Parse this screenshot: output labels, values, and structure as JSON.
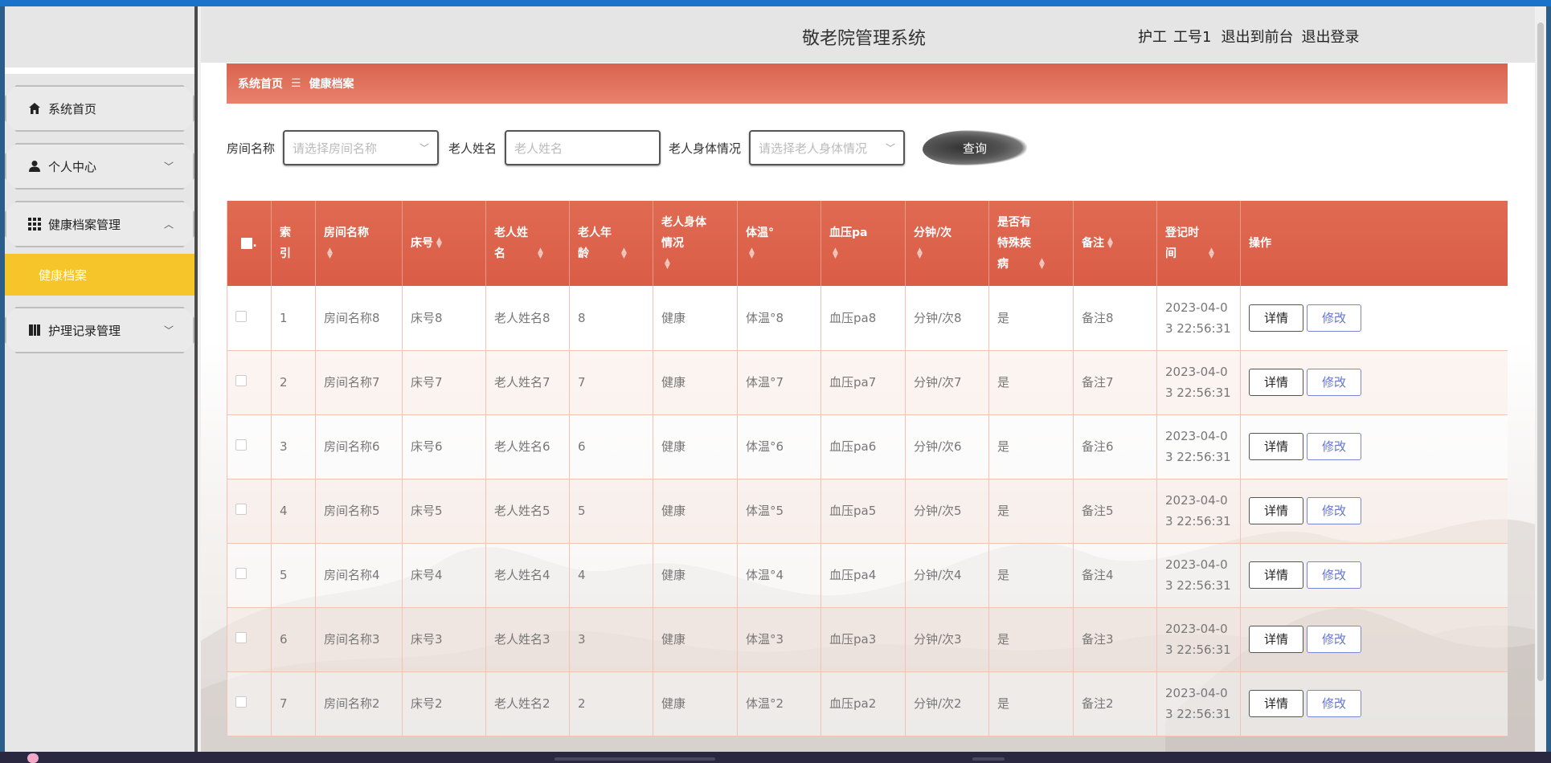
{
  "header": {
    "title": "敬老院管理系统",
    "role": "护工",
    "username": "工号1",
    "front_link": "退出到前台",
    "logout_link": "退出登录"
  },
  "sidebar": {
    "items": [
      {
        "label": "系统首页",
        "icon": "home-icon"
      },
      {
        "label": "个人中心",
        "icon": "user-icon"
      },
      {
        "label": "健康档案管理",
        "icon": "grid-icon"
      },
      {
        "label": "健康档案",
        "icon": ""
      },
      {
        "label": "护理记录管理",
        "icon": "book-icon"
      }
    ]
  },
  "breadcrumb": {
    "home": "系统首页",
    "separator": "☰",
    "current": "健康档案"
  },
  "search": {
    "room_label": "房间名称",
    "room_placeholder": "请选择房间名称",
    "name_label": "老人姓名",
    "name_placeholder": "老人姓名",
    "health_label": "老人身体情况",
    "health_placeholder": "请选择老人身体情况",
    "query_button": "查询"
  },
  "table": {
    "columns": [
      "索引",
      "房间名称",
      "床号",
      "老人姓名",
      "老人年龄",
      "老人身体情况",
      "体温°",
      "血压pa",
      "分钟/次",
      "是否有特殊疾病",
      "备注",
      "登记时间",
      "操作"
    ],
    "detail_label": "详情",
    "edit_label": "修改",
    "rows": [
      {
        "index": "1",
        "room": "房间名称8",
        "bed": "床号8",
        "name": "老人姓名8",
        "age": "8",
        "health": "健康",
        "temp": "体温°8",
        "bp": "血压pa8",
        "rate": "分钟/次8",
        "disease": "是",
        "note": "备注8",
        "time1": "2023-04-0",
        "time2": "3 22:56:31"
      },
      {
        "index": "2",
        "room": "房间名称7",
        "bed": "床号7",
        "name": "老人姓名7",
        "age": "7",
        "health": "健康",
        "temp": "体温°7",
        "bp": "血压pa7",
        "rate": "分钟/次7",
        "disease": "是",
        "note": "备注7",
        "time1": "2023-04-0",
        "time2": "3 22:56:31"
      },
      {
        "index": "3",
        "room": "房间名称6",
        "bed": "床号6",
        "name": "老人姓名6",
        "age": "6",
        "health": "健康",
        "temp": "体温°6",
        "bp": "血压pa6",
        "rate": "分钟/次6",
        "disease": "是",
        "note": "备注6",
        "time1": "2023-04-0",
        "time2": "3 22:56:31"
      },
      {
        "index": "4",
        "room": "房间名称5",
        "bed": "床号5",
        "name": "老人姓名5",
        "age": "5",
        "health": "健康",
        "temp": "体温°5",
        "bp": "血压pa5",
        "rate": "分钟/次5",
        "disease": "是",
        "note": "备注5",
        "time1": "2023-04-0",
        "time2": "3 22:56:31"
      },
      {
        "index": "5",
        "room": "房间名称4",
        "bed": "床号4",
        "name": "老人姓名4",
        "age": "4",
        "health": "健康",
        "temp": "体温°4",
        "bp": "血压pa4",
        "rate": "分钟/次4",
        "disease": "是",
        "note": "备注4",
        "time1": "2023-04-0",
        "time2": "3 22:56:31"
      },
      {
        "index": "6",
        "room": "房间名称3",
        "bed": "床号3",
        "name": "老人姓名3",
        "age": "3",
        "health": "健康",
        "temp": "体温°3",
        "bp": "血压pa3",
        "rate": "分钟/次3",
        "disease": "是",
        "note": "备注3",
        "time1": "2023-04-0",
        "time2": "3 22:56:31"
      },
      {
        "index": "7",
        "room": "房间名称2",
        "bed": "床号2",
        "name": "老人姓名2",
        "age": "2",
        "health": "健康",
        "temp": "体温°2",
        "bp": "血压pa2",
        "rate": "分钟/次2",
        "disease": "是",
        "note": "备注2",
        "time1": "2023-04-0",
        "time2": "3 22:56:31"
      }
    ]
  },
  "colors": {
    "accent": "#dc5f48",
    "submenu_active": "#f6c52a"
  }
}
